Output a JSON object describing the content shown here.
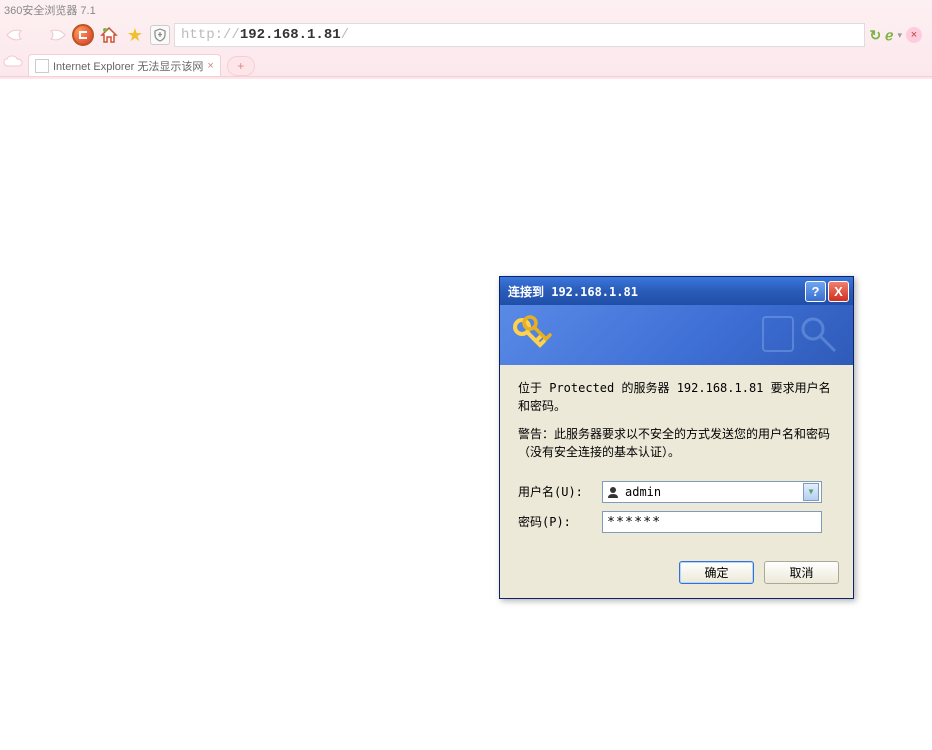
{
  "browser": {
    "title": "360安全浏览器 7.1",
    "url_protocol": "http://",
    "url_host": "192.168.1.81",
    "url_path": "/"
  },
  "tab": {
    "title": "Internet Explorer 无法显示该网"
  },
  "dialog": {
    "title": "连接到 192.168.1.81",
    "message1": "位于 Protected 的服务器 192.168.1.81 要求用户名和密码。",
    "message2": "警告：此服务器要求以不安全的方式发送您的用户名和密码（没有安全连接的基本认证）。",
    "username_label": "用户名(U):",
    "username_value": "admin",
    "password_label": "密码(P):",
    "password_value": "******",
    "ok_label": "确定",
    "cancel_label": "取消"
  }
}
